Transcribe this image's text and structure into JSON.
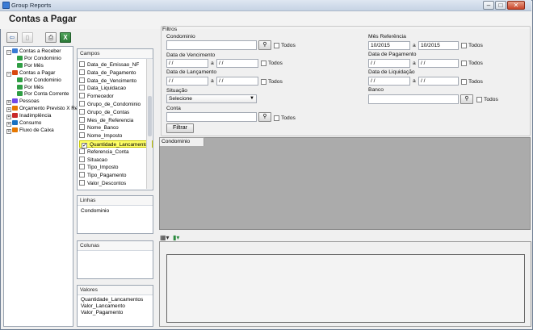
{
  "window": {
    "title": "Group Reports"
  },
  "page_title": "Contas a Pagar",
  "colors": {
    "titlebar": "#c6d3e4",
    "highlight": "#ffff66",
    "grid_bg": "#ababab"
  },
  "tree": [
    {
      "label": "Contas a Receber",
      "level": 0,
      "expander": "−"
    },
    {
      "label": "Por Condominio",
      "level": 1
    },
    {
      "label": "Por Mês",
      "level": 1
    },
    {
      "label": "Contas a Pagar",
      "level": 0,
      "expander": "−"
    },
    {
      "label": "Por Condominio",
      "level": 1
    },
    {
      "label": "Por Mês",
      "level": 1
    },
    {
      "label": "Por Conta Corrente",
      "level": 1
    },
    {
      "label": "Pessoas",
      "level": 0,
      "expander": "+"
    },
    {
      "label": "Orçamento Previsto X Re",
      "level": 0,
      "expander": "+"
    },
    {
      "label": "Inadimplência",
      "level": 0,
      "expander": "+"
    },
    {
      "label": "Consumo",
      "level": 0,
      "expander": "+"
    },
    {
      "label": "Fluxo de Caixa",
      "level": 0,
      "expander": "+"
    }
  ],
  "campos": {
    "header": "Campos",
    "items": [
      {
        "label": "Data_de_Emissao_NF",
        "checked": false
      },
      {
        "label": "Data_de_Pagamento",
        "checked": false
      },
      {
        "label": "Data_de_Vencimento",
        "checked": false
      },
      {
        "label": "Data_Liquidacao",
        "checked": false
      },
      {
        "label": "Fornecedor",
        "checked": false
      },
      {
        "label": "Grupo_de_Condominio",
        "checked": false
      },
      {
        "label": "Grupo_de_Contas",
        "checked": false
      },
      {
        "label": "Mes_de_Referencia",
        "checked": false
      },
      {
        "label": "Nome_Banco",
        "checked": false
      },
      {
        "label": "Nome_Imposto",
        "checked": false
      },
      {
        "label": "Quantidade_Lancamentos",
        "checked": true
      },
      {
        "label": "Referencia_Conta",
        "checked": false
      },
      {
        "label": "Situacao",
        "checked": false
      },
      {
        "label": "Tipo_Imposto",
        "checked": false
      },
      {
        "label": "Tipo_Pagamento",
        "checked": false
      },
      {
        "label": "Valor_Descontos",
        "checked": false
      }
    ]
  },
  "linhas": {
    "header": "Linhas",
    "items": [
      "Condominio"
    ]
  },
  "colunas": {
    "header": "Colunas",
    "items": []
  },
  "valores": {
    "header": "Valores",
    "items": [
      "Quantidade_Lancamentos",
      "Valor_Lancamento",
      "Valor_Pagamento"
    ]
  },
  "filtros": {
    "title": "Filtros",
    "condominio_label": "Condominio",
    "data_vencimento_label": "Data de Vencimento",
    "data_lancamento_label": "Data de Lançamento",
    "situacao_label": "Situação",
    "situacao_value": "Selecione",
    "conta_label": "Conta",
    "mes_referencia_label": "Mês Referência",
    "mes_ref_from": "10/2015",
    "mes_ref_to": "10/2015",
    "data_pagamento_label": "Data de Pagamento",
    "data_liquidacao_label": "Data de Liquidação",
    "banco_label": "Banco",
    "todos": "Todos",
    "a": "a",
    "date_placeholder": " /  /",
    "filtrar_button": "Filtrar"
  },
  "grid": {
    "tab_label": "Condominio"
  }
}
